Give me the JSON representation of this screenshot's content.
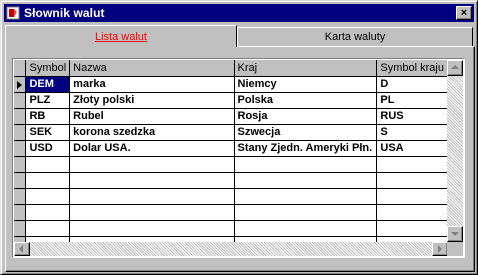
{
  "window": {
    "title": "Słownik walut",
    "close_glyph": "×"
  },
  "tabs": [
    {
      "label": "Lista walut",
      "active": true
    },
    {
      "label": "Karta waluty",
      "active": false
    }
  ],
  "grid": {
    "columns": [
      "Symbol",
      "Nazwa",
      "Kraj",
      "Symbol kraju"
    ],
    "rows": [
      {
        "symbol": "DEM",
        "nazwa": "marka",
        "kraj": "Niemcy",
        "symbol_kraju": "D"
      },
      {
        "symbol": "PLZ",
        "nazwa": "Złoty polski",
        "kraj": "Polska",
        "symbol_kraju": "PL"
      },
      {
        "symbol": "RB",
        "nazwa": "Rubel",
        "kraj": "Rosja",
        "symbol_kraju": "RUS"
      },
      {
        "symbol": "SEK",
        "nazwa": "korona szedzka",
        "kraj": "Szwecja",
        "symbol_kraju": "S"
      },
      {
        "symbol": "USD",
        "nazwa": "Dolar USA.",
        "kraj": "Stany Zjedn. Ameryki Płn.",
        "symbol_kraju": "USA"
      }
    ],
    "selected_row": 0
  },
  "colors": {
    "titlebar": "#000080",
    "active_tab_text": "#ff0000",
    "selection": "#000080",
    "face": "#c0c0c0"
  }
}
